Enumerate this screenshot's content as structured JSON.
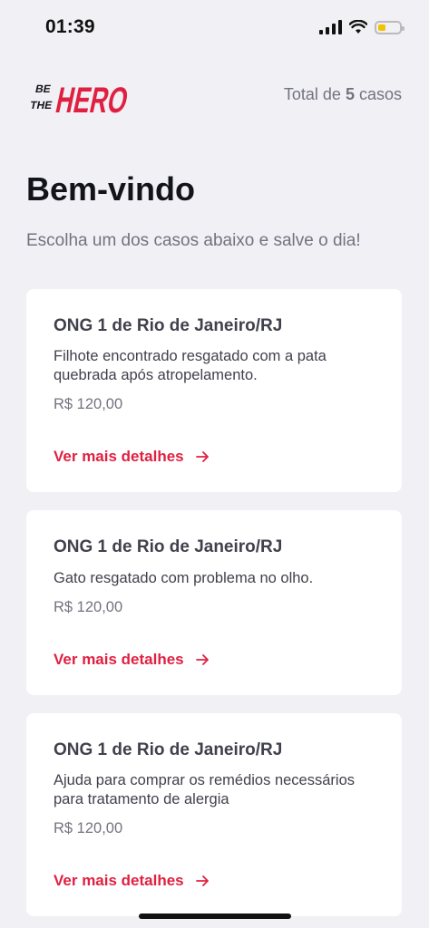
{
  "status_bar": {
    "time": "01:39",
    "battery_level": 0.35
  },
  "header": {
    "logo_text": {
      "line1": "BE",
      "line2": "THE",
      "brand": "HERO"
    },
    "total_prefix": "Total de",
    "total_count": "5",
    "total_suffix": "casos"
  },
  "page": {
    "title": "Bem-vindo",
    "subtitle": "Escolha um dos casos abaixo e salve o dia!"
  },
  "cases": [
    {
      "ong": "ONG 1 de Rio de Janeiro/RJ",
      "description": "Filhote encontrado resgatado com a pata quebrada após atropelamento.",
      "value": "R$ 120,00",
      "link": "Ver mais detalhes"
    },
    {
      "ong": "ONG 1 de Rio de Janeiro/RJ",
      "description": "Gato resgatado com problema no olho.",
      "value": "R$ 120,00",
      "link": "Ver mais detalhes"
    },
    {
      "ong": "ONG 1 de Rio de Janeiro/RJ",
      "description": "Ajuda para comprar os remédios necessários para tratamento de alergia",
      "value": "R$ 120,00",
      "link": "Ver mais detalhes"
    }
  ],
  "colors": {
    "accent": "#e02041",
    "background": "#f0f0f5",
    "muted": "#737380"
  }
}
